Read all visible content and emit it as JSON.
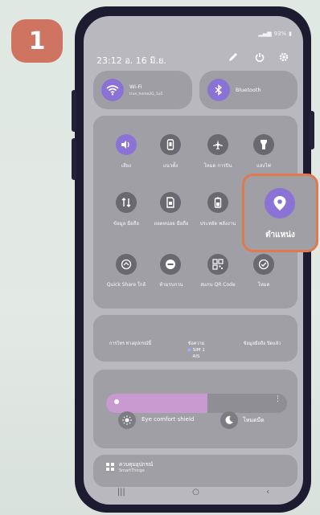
{
  "step_badge": "1",
  "status_bar": {
    "battery": "93%"
  },
  "header": {
    "time": "23:12 อ. 16 มิ.ย."
  },
  "wifi_tile": {
    "title": "Wi-Fi",
    "subtitle": "true_home2G_1a5"
  },
  "bluetooth_tile": {
    "title": "Bluetooth"
  },
  "quick_settings": [
    {
      "label": "เสียง",
      "icon": "sound-icon",
      "active": true
    },
    {
      "label": "แนวตั้ง",
      "icon": "portrait-icon",
      "active": false
    },
    {
      "label": "โหมด การบิน",
      "icon": "airplane-icon",
      "active": false
    },
    {
      "label": "แสงไฟ",
      "icon": "flashlight-icon",
      "active": false
    },
    {
      "label": "ข้อมูล มือถือ",
      "icon": "mobile-data-icon",
      "active": false
    },
    {
      "label": "ถอดหน่อย มือถือ",
      "icon": "sim-icon",
      "active": false
    },
    {
      "label": "ประหยัด พลังงาน",
      "icon": "battery-icon",
      "active": false
    },
    {
      "label": "Quick Share ใกล้",
      "icon": "quick-share-icon",
      "active": false
    },
    {
      "label": "ห้ามรบกวน",
      "icon": "do-not-disturb-icon",
      "active": false
    },
    {
      "label": "สแกน QR Code",
      "icon": "qr-code-icon",
      "active": false
    },
    {
      "label": "โหมด",
      "icon": "mode-icon",
      "active": false
    }
  ],
  "highlight_tile": {
    "label": "ตำแหน่ง",
    "icon": "location-icon"
  },
  "network_info": {
    "left": "การโทร ทางอุปกรณ์นี้",
    "center_title": "ข้อความ",
    "center_sim": "SIM 1",
    "center_carrier": "AIS",
    "right": "ข้อมูลมือถือ ปิดแล้ว"
  },
  "brightness": {
    "level": 0.56
  },
  "eye_comfort": {
    "label": "Eye comfort shield"
  },
  "dark_mode": {
    "label": "โหมดมืด"
  },
  "smartthings": {
    "title": "ควบคุมอุปกรณ์",
    "subtitle": "SmartThings"
  },
  "colors": {
    "accent": "#8b73d6",
    "highlight": "#df7a4f",
    "badge": "#cf7460"
  }
}
